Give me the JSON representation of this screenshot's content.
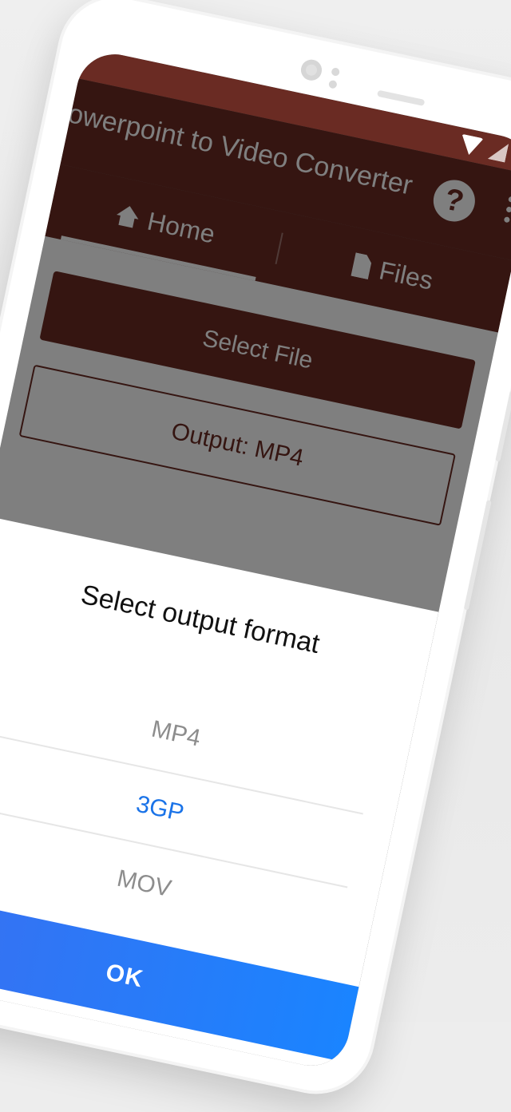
{
  "app": {
    "title": "Powerpoint to Video Converter"
  },
  "tabs": [
    {
      "label": "Home",
      "icon": "home-icon",
      "active": true
    },
    {
      "label": "Files",
      "icon": "file-icon",
      "active": false
    }
  ],
  "actions": {
    "help_label": "?",
    "select_file_label": "Select File",
    "output_label": "Output: MP4"
  },
  "dialog": {
    "title": "Select output format",
    "options": [
      "MP4",
      "3GP",
      "MOV"
    ],
    "selected": "3GP",
    "ok_label": "OK"
  },
  "colors": {
    "primary": "#6a2b23",
    "accent": "#1a73e8",
    "ok_gradient_start": "#3a6ff0",
    "ok_gradient_end": "#1a84ff"
  }
}
